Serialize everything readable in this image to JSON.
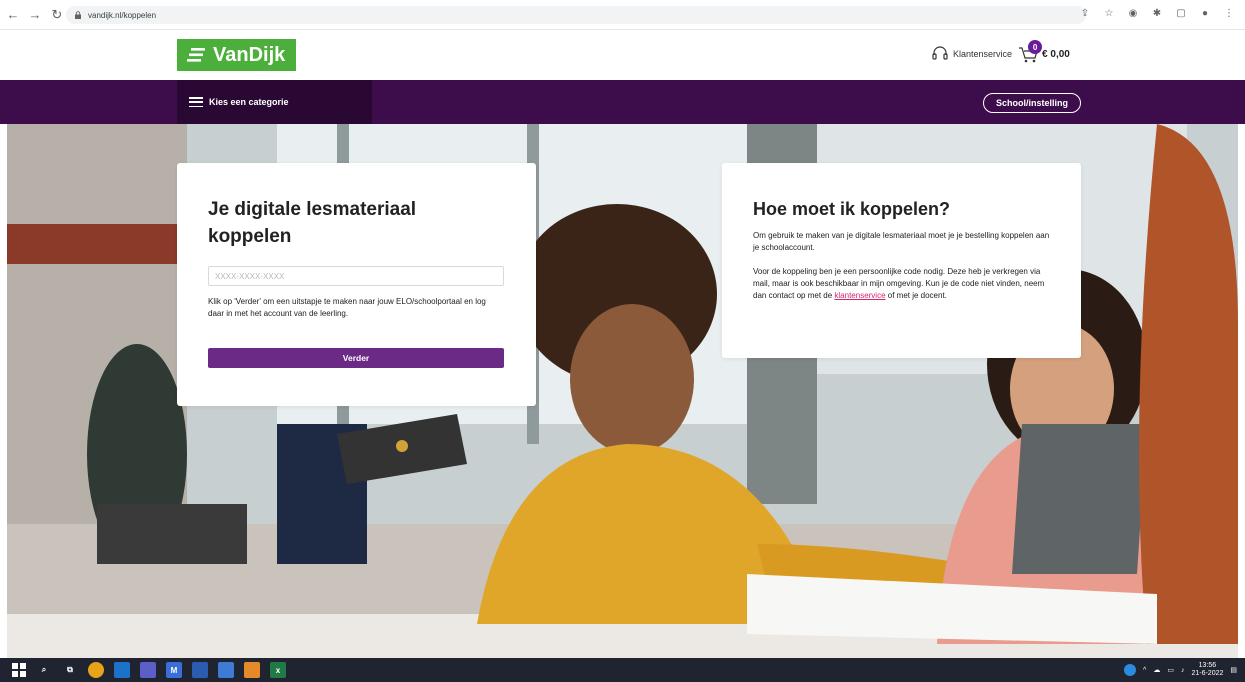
{
  "browser": {
    "url": "vandijk.nl/koppelen"
  },
  "header": {
    "logo_text": "VanDijk",
    "klantenservice": "Klantenservice",
    "cart_count": "0",
    "cart_total": "€ 0,00"
  },
  "nav": {
    "category": "Kies een categorie",
    "school": "School/instelling"
  },
  "card_left": {
    "title_line1": "Je digitale lesmateriaal",
    "title_line2": "koppelen",
    "code_placeholder": "XXXX-XXXX-XXXX",
    "description": "Klik op 'Verder' om een uitstapje te maken naar jouw ELO/schoolportaal en log daar in met het account van de leerling.",
    "button": "Verder"
  },
  "card_right": {
    "title": "Hoe moet ik koppelen?",
    "para1": "Om gebruik te maken van je digitale lesmateriaal moet je je bestelling koppelen aan je schoolaccount.",
    "para2_before": "Voor de koppeling ben je een persoonlijke code nodig. Deze heb je verkregen via mail, maar is ook beschikbaar in mijn omgeving. Kun je de code niet vinden, neem dan contact op met de ",
    "para2_link": "klantenservice",
    "para2_after": " of met je docent."
  },
  "taskbar": {
    "time": "13:56",
    "date": "21-6-2022"
  },
  "colors": {
    "brand_green": "#4caf3b",
    "nav_purple": "#3c0d4a",
    "button_purple": "#6a2a86",
    "link_pink": "#d6246e"
  }
}
